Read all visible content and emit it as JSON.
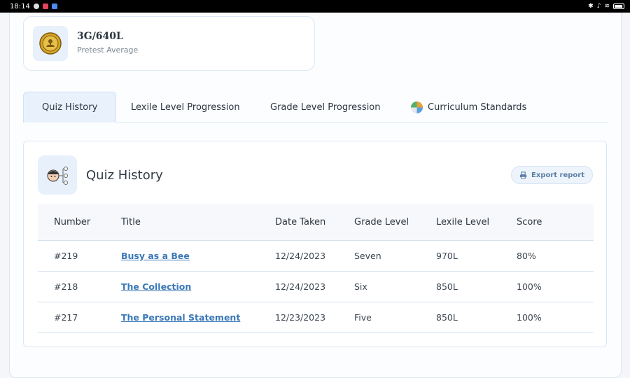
{
  "status_bar": {
    "time": "18:14"
  },
  "pretest": {
    "value": "3G/640L",
    "label": "Pretest Average"
  },
  "tabs": [
    {
      "label": "Quiz History"
    },
    {
      "label": "Lexile Level Progression"
    },
    {
      "label": "Grade Level Progression"
    },
    {
      "label": "Curriculum Standards"
    }
  ],
  "panel": {
    "title": "Quiz History",
    "export_label": "Export report"
  },
  "table": {
    "headers": [
      "Number",
      "Title",
      "Date Taken",
      "Grade Level",
      "Lexile Level",
      "Score"
    ],
    "rows": [
      [
        "#219",
        "Busy as a Bee",
        "12/24/2023",
        "Seven",
        "970L",
        "80%"
      ],
      [
        "#218",
        "The Collection",
        "12/24/2023",
        "Six",
        "850L",
        "100%"
      ],
      [
        "#217",
        "The Personal Statement",
        "12/23/2023",
        "Five",
        "850L",
        "100%"
      ]
    ]
  },
  "colors": {
    "accent": "#3a78b8",
    "active_tab_bg": "#e9f2fc",
    "card_border": "#d9e7f6"
  },
  "icons": {
    "medal": "medal-icon",
    "pie": "pie-chart-icon",
    "quiz": "student-network-icon",
    "export": "printer-icon"
  }
}
